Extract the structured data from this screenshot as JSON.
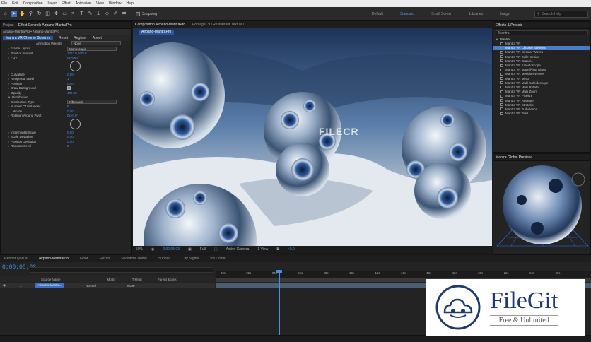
{
  "menu": [
    "File",
    "Edit",
    "Composition",
    "Layer",
    "Effect",
    "Animation",
    "View",
    "Window",
    "Help"
  ],
  "toolbar": {
    "snapping_label": "Snapping"
  },
  "workspaces": [
    "Default",
    "Standard",
    "Small Screen",
    "Libraries",
    "Image"
  ],
  "active_workspace": "Standard",
  "help_search_placeholder": "Search Help",
  "left_panel": {
    "tabs": [
      "Project",
      "Effect Controls Airpano-MantraPro"
    ],
    "breadcrumb": "Airpano-MantraPro • Airpano-MantraPro",
    "effect_header": "Mantra VR Chrome Spheres",
    "sub_tabs": [
      "Reset",
      "Register",
      "About"
    ],
    "animation_presets_label": "Animation Presets",
    "animation_presets_value": "None",
    "properties": [
      {
        "name": "Frame Layout",
        "value": "Monoscopic",
        "kind": "dropdown"
      },
      {
        "name": "Point of Interest",
        "value": "1712.0, 878.0",
        "kind": "value"
      },
      {
        "name": "FOV",
        "value": "0x+66.0°",
        "kind": "value"
      },
      {
        "name": "",
        "value": "",
        "kind": "dial"
      },
      {
        "name": "Curvature",
        "value": "0.00",
        "kind": "value"
      },
      {
        "name": "Reciprocal Level",
        "value": "1",
        "kind": "value"
      },
      {
        "name": "Position",
        "value": "0.00",
        "kind": "value"
      },
      {
        "name": "Draw Background",
        "value": "",
        "kind": "checkbox"
      },
      {
        "name": "Opacity",
        "value": "100.00",
        "kind": "value"
      },
      {
        "name": "Distribution",
        "value": "",
        "kind": "group"
      },
      {
        "name": "Distribution Type",
        "value": "Fibonacci",
        "kind": "dropdown"
      },
      {
        "name": "Number Of Instances",
        "value": "6",
        "kind": "value"
      },
      {
        "name": "Latitude",
        "value": "0.00",
        "kind": "value"
      },
      {
        "name": "Rotation Around Pivot",
        "value": "0x+0.0°",
        "kind": "value"
      },
      {
        "name": "",
        "value": "",
        "kind": "dial"
      },
      {
        "name": "Incremental Scale",
        "value": "0.00",
        "kind": "value"
      },
      {
        "name": "Scale Deviation",
        "value": "0.00",
        "kind": "value"
      },
      {
        "name": "Position Deviation",
        "value": "0.00",
        "kind": "value"
      },
      {
        "name": "Random Seed",
        "value": "0",
        "kind": "value"
      }
    ]
  },
  "composition": {
    "tabs": [
      "Composition Airpano-MantraPro",
      "Footage: 3D Restaurant Texture1"
    ],
    "active_label": "Airpano-MantraPro",
    "zoom": "50%",
    "timecode": "0;00;05;03",
    "resolution": "Full",
    "camera": "Active Camera",
    "view": "1 View",
    "exposure": "+0.0"
  },
  "watermark_center": "FILECR",
  "effects_panel": {
    "title": "Effects & Presets",
    "search_value": "Mantra",
    "category": "Mantra",
    "items": [
      "Mantra VR",
      "Mantra VR Chrome Spheres",
      "Mantra VR Circular Waves",
      "Mantra VR Bullet Brains",
      "Mantra VR Graphic",
      "Mantra VR Kaleidoscope",
      "Mantra VR Magnifying Glass",
      "Mantra VR Meridian Waves",
      "Mantra VR Mirror",
      "Mantra VR Multi Kaleidoscope",
      "Mantra VR Multi Rotate",
      "Mantra VR Multi Zoom",
      "Mantra VR Pixelize",
      "Mantra VR Repeater",
      "Mantra VR Stretcher",
      "Mantra VR Turbulence",
      "Mantra VR Twirl"
    ],
    "selected_index": 1,
    "preview_title": "Mantra Global Preview"
  },
  "timeline": {
    "tabs": [
      "Render Queue",
      "Airpano-MantraPro",
      "Floor",
      "Ferrari",
      "Showtime Dome",
      "Sunbird",
      "City Nights",
      "Ice Dome"
    ],
    "active_tab": "Airpano-MantraPro",
    "timecode": "0;00;05;03",
    "columns": [
      "Source Name",
      "Mode",
      "TrkMat",
      "Parent & Link"
    ],
    "layer_index": "1",
    "layer_name": "Airpano-Mantra...",
    "layer_mode": "Normal",
    "layer_parent": "None",
    "ruler_labels": [
      "00s",
      "02s",
      "04s",
      "06s",
      "08s",
      "10s",
      "12s",
      "14s",
      "16s",
      "18s",
      "20s",
      "22s",
      "24s",
      "26s"
    ]
  },
  "filegit": {
    "title": "FileGit",
    "tagline": "Free & Unlimited",
    "color": "#1f3a73"
  }
}
